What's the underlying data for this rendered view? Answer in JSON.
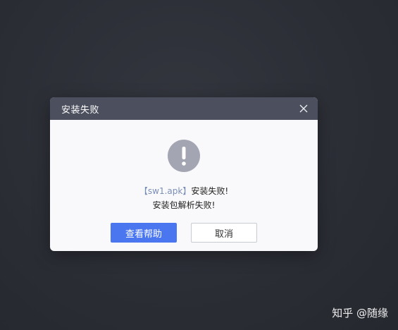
{
  "dialog": {
    "title": "安装失败",
    "icon": "exclamation-circle-icon",
    "message": {
      "file_label": "【sw1.apk】",
      "line1_suffix": "安装失败!",
      "line2": "安装包解析失败!"
    },
    "buttons": {
      "help_label": "查看帮助",
      "cancel_label": "取消"
    }
  },
  "watermark": "知乎 @随缘",
  "colors": {
    "titlebar": "#4c4f5e",
    "primary": "#4a77ef",
    "icon": "#a3a6b2",
    "background": "#2c2e36"
  }
}
